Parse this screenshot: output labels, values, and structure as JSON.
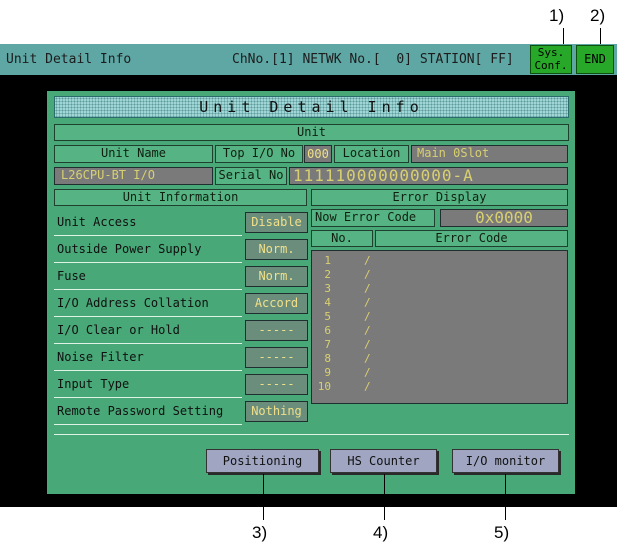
{
  "callouts": [
    "1)",
    "2)",
    "3)",
    "4)",
    "5)"
  ],
  "titlebar": {
    "title": "Unit Detail Info",
    "channel": "ChNo.[1] NETWK No.[  0] STATION[ FF]",
    "sys_conf_line1": "Sys.",
    "sys_conf_line2": "Conf.",
    "end": "END"
  },
  "banner": "Unit Detail Info",
  "unit": {
    "section": "Unit",
    "name_label": "Unit Name",
    "name_value": "L26CPU-BT I/O",
    "top_io_label": "Top I/O No",
    "top_io_value": "000",
    "location_label": "Location",
    "location_value": "Main  0Slot",
    "serial_label": "Serial No",
    "serial_value": "111110000000000-A"
  },
  "unit_information": {
    "header": "Unit Information",
    "rows": [
      {
        "label": "Unit Access",
        "value": "Disable"
      },
      {
        "label": "Outside Power Supply",
        "value": "Norm."
      },
      {
        "label": "Fuse",
        "value": "Norm."
      },
      {
        "label": "I/O Address Collation",
        "value": "Accord"
      },
      {
        "label": "I/O Clear or Hold",
        "value": "-----"
      },
      {
        "label": "Noise Filter",
        "value": "-----"
      },
      {
        "label": "Input Type",
        "value": "-----"
      },
      {
        "label": "Remote Password Setting",
        "value": "Nothing"
      }
    ]
  },
  "error_display": {
    "header": "Error Display",
    "now_label": "Now Error Code",
    "now_value": "0x0000",
    "col_no": "No.",
    "col_code": "Error Code",
    "rows": [
      {
        "no": "1",
        "sep": "/"
      },
      {
        "no": "2",
        "sep": "/"
      },
      {
        "no": "3",
        "sep": "/"
      },
      {
        "no": "4",
        "sep": "/"
      },
      {
        "no": "5",
        "sep": "/"
      },
      {
        "no": "6",
        "sep": "/"
      },
      {
        "no": "7",
        "sep": "/"
      },
      {
        "no": "8",
        "sep": "/"
      },
      {
        "no": "9",
        "sep": "/"
      },
      {
        "no": "10",
        "sep": "/"
      }
    ]
  },
  "buttons": {
    "positioning": "Positioning",
    "hs_counter": "HS Counter",
    "io_monitor": "I/O monitor"
  }
}
